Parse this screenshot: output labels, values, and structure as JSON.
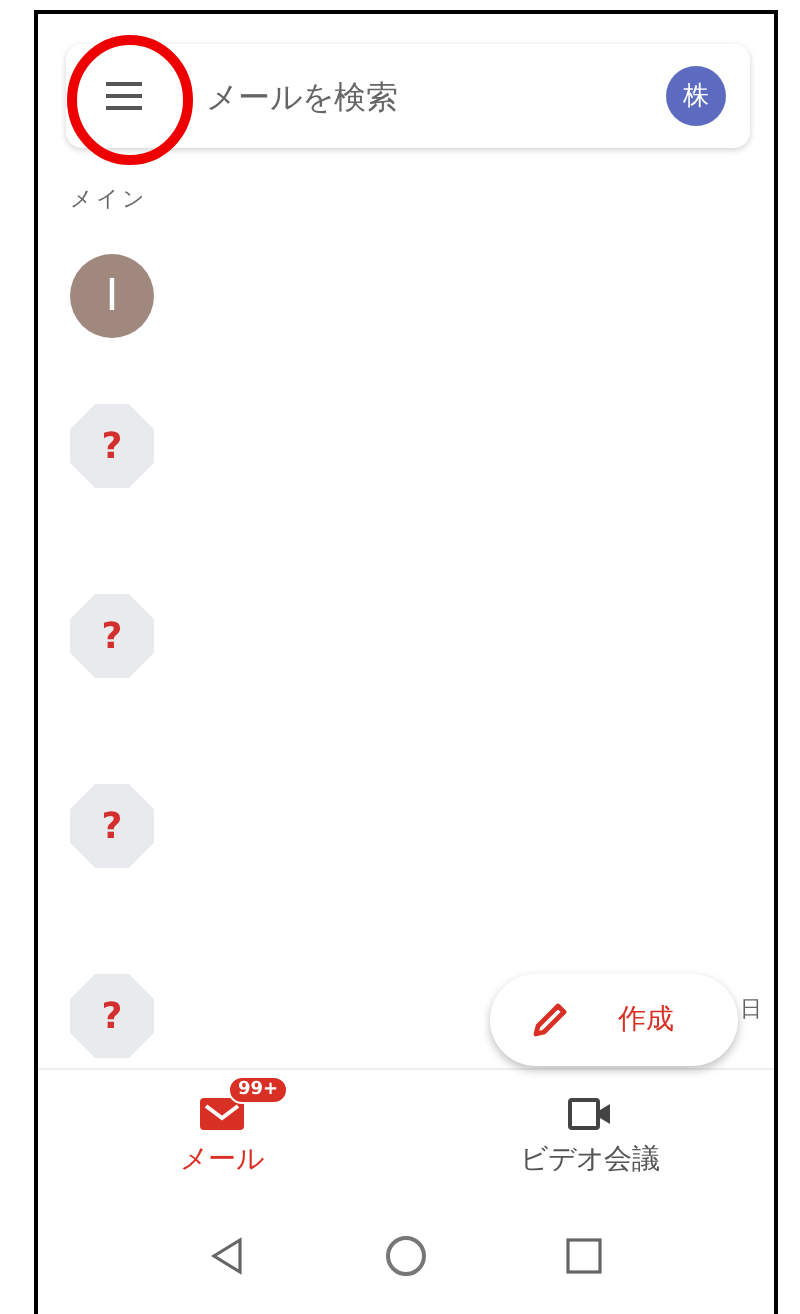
{
  "search": {
    "placeholder": "メールを検索",
    "account_initial": "株"
  },
  "section_label": "メイン",
  "messages": [
    {
      "kind": "letter",
      "avatar": "I"
    },
    {
      "kind": "unknown",
      "avatar": "?"
    },
    {
      "kind": "unknown",
      "avatar": "?"
    },
    {
      "kind": "unknown",
      "avatar": "?"
    },
    {
      "kind": "unknown",
      "avatar": "?"
    }
  ],
  "partial_date": "日",
  "compose_button": {
    "label": "作成"
  },
  "bottom_nav": [
    {
      "kind": "mail",
      "label": "メール",
      "badge": "99+",
      "selected": true
    },
    {
      "kind": "video",
      "label": "ビデオ会議",
      "selected": false
    }
  ],
  "annotation": {
    "kind": "circle"
  }
}
